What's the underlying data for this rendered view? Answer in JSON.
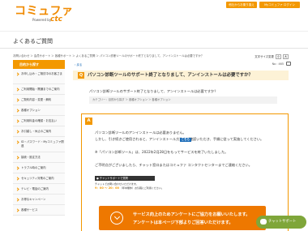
{
  "header": {
    "logo_main": "コミュファ",
    "logo_sub": "Powered by",
    "logo_ctc": "ctc",
    "btn_new": "他社からお乗り換え",
    "btn_mypage": "Myコミュファ ログイン",
    "title": "よくあるご質問"
  },
  "breadcrumb": "お問い合わせ ＞ 会員サポート ＞ 各種サポート ＞ よくあるご質問 ＞ パソコン診断ツールのサポート終了となりまして、アンインストールは必要ですか？",
  "sidebar": {
    "head": "目的から探す",
    "items": [
      "お申し込み・ご検討中のお客さま",
      "ご利用開始・開通までのご案内",
      "ご契約内容・変更・解約",
      "各種オプション",
      "ご利用料金の確認・お支払い",
      "お引越し・休止のご案内",
      "ID・パスワード・Myコミュファ関連",
      "接続・設定方法",
      "トラブル時のご案内",
      "セキュリティ対策のご案内",
      "テレビ・電話のご案内",
      "お得なキャンペーン",
      "各種サービス"
    ]
  },
  "main": {
    "font_size_label": "文字サイズ変更",
    "fs_small": "小",
    "fs_large": "大",
    "back": "戻る",
    "faq_no": "No : 465",
    "question_badge": "Q",
    "question": "パソコン診断ツールのサポート終了となりまして、アンインストールは必要ですか？",
    "question_detail": "パソコン診断ツールのサポート終了となりまして、アンインストールは必要ですか？",
    "category": "カテゴリー：目的から探す ＞ 各種オプション ＞ 各種オプション",
    "answer_badge": "A",
    "answer_lines": [
      "パソコン診断ツールのアンインストールは必要ありません。",
      "しかし、引き続きご使用されると、アンインストール方法をご確認いただき、手順に従って実施してください。",
      "※「パソコン診断ツール」は、2022年2月28日をもってサービスを終了いたしました。",
      "ご不明点がございましたら、チャット窓口またはコミュファ コンタクトセンターまでご連絡ください。"
    ],
    "here_label": "こちら",
    "chat_bar": "● チャットサポートで質問",
    "chat_info_1": "チャットでお問い合わせいただけます。",
    "chat_time": "9：00 ～ 20：00",
    "chat_info_2": "（年中無休）お気軽にご利用ください。"
  },
  "survey": {
    "line1": "サービス向上のためアンケートにご協力をお願いいたします。",
    "line2": "アンケートは本ページ下部よりご回答いただけます。"
  },
  "chat_support": "チャットサポート"
}
